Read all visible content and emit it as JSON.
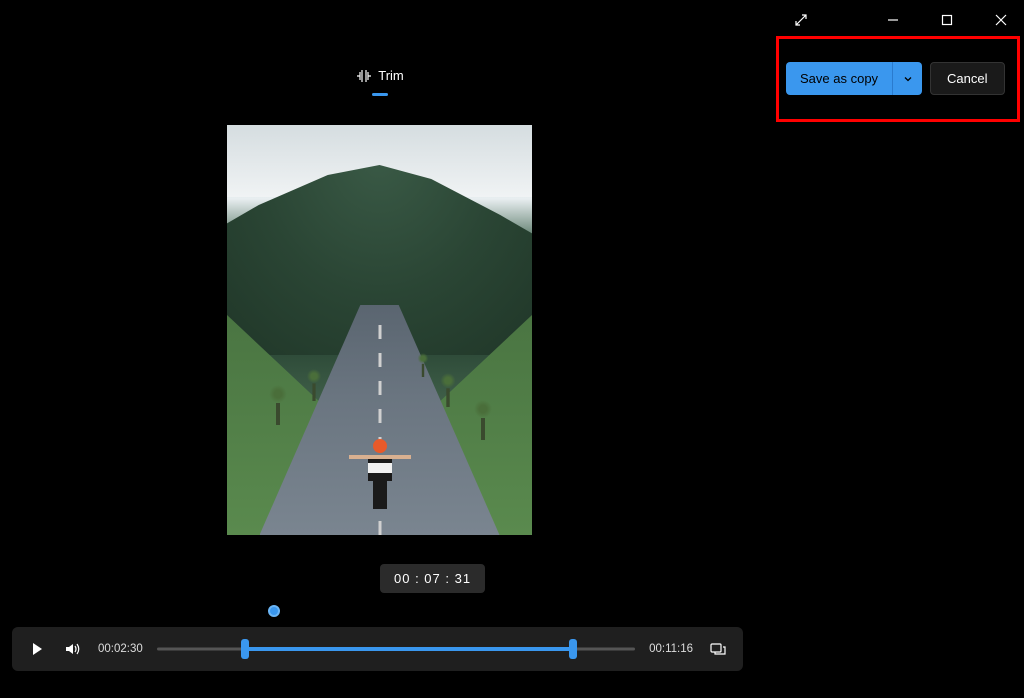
{
  "titlebar": {
    "fullscreen_icon": "fullscreen",
    "minimize_icon": "minimize",
    "maximize_icon": "maximize",
    "close_icon": "close"
  },
  "actions": {
    "save_label": "Save as copy",
    "cancel_label": "Cancel"
  },
  "tabs": {
    "trim_label": "Trim"
  },
  "badge": {
    "current_frame_time": "00 : 07 : 31"
  },
  "player": {
    "elapsed": "00:02:30",
    "total": "00:11:16"
  }
}
